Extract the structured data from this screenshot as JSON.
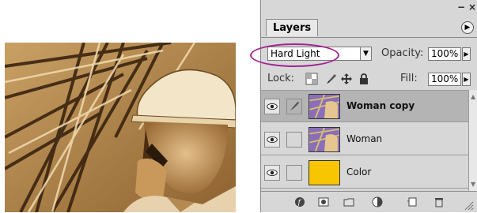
{
  "photo": {
    "description_icon": "construction-worker-photo"
  },
  "palette": {
    "window_buttons": {
      "minimize": "−",
      "close": "×"
    },
    "tab_label": "Layers",
    "menu_icon": "▶",
    "blend_mode": "Hard Light",
    "opacity_label": "Opacity:",
    "opacity_value": "100%",
    "lock_label": "Lock:",
    "fill_label": "Fill:",
    "fill_value": "100%",
    "layers": [
      {
        "name": "Woman copy",
        "selected": true,
        "thumb": "woman-thumbnail"
      },
      {
        "name": "Woman",
        "selected": false,
        "thumb": "woman-thumbnail"
      },
      {
        "name": "Color",
        "selected": false,
        "thumb": "yellow-fill",
        "color": "#f7c600"
      }
    ],
    "colors": {
      "highlight_circle": "#a3248f",
      "selected_row": "#b4b4b4",
      "panel": "#d7d7d7"
    }
  }
}
